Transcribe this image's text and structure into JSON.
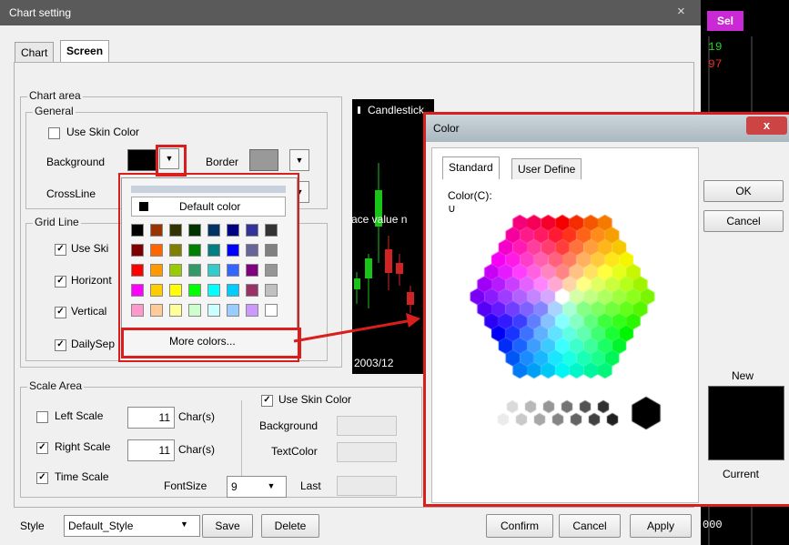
{
  "window": {
    "title": "Chart setting",
    "close_glyph": "×"
  },
  "tabs": [
    {
      "label": "Chart"
    },
    {
      "label": "Screen"
    }
  ],
  "chart_area": {
    "label": "Chart area",
    "general": {
      "label": "General",
      "use_skin_color": "Use Skin Color",
      "background_label": "Background",
      "border_label": "Border",
      "crossline_label": "CrossLine"
    },
    "grid_line": {
      "label": "Grid Line",
      "items": [
        "Use Ski",
        "Horizont",
        "Vertical",
        "DailySep"
      ]
    }
  },
  "popup": {
    "default_color": "Default color",
    "more_colors": "More colors...",
    "palette": [
      [
        "#000000",
        "#993300",
        "#333300",
        "#003300",
        "#003366",
        "#000080",
        "#333399",
        "#333333"
      ],
      [
        "#800000",
        "#FF6600",
        "#808000",
        "#008000",
        "#008080",
        "#0000FF",
        "#666699",
        "#808080"
      ],
      [
        "#FF0000",
        "#FF9900",
        "#99CC00",
        "#339966",
        "#33CCCC",
        "#3366FF",
        "#800080",
        "#969696"
      ],
      [
        "#FF00FF",
        "#FFCC00",
        "#FFFF00",
        "#00FF00",
        "#00FFFF",
        "#00CCFF",
        "#993366",
        "#C0C0C0"
      ],
      [
        "#FF99CC",
        "#FFCC99",
        "#FFFF99",
        "#CCFFCC",
        "#CCFFFF",
        "#99CCFF",
        "#CC99FF",
        "#FFFFFF"
      ]
    ]
  },
  "preview": {
    "title": "Candlestick",
    "text_mid": "ace value n",
    "date": "2003/12"
  },
  "scale_area": {
    "label": "Scale Area",
    "left_scale": "Left Scale",
    "right_scale": "Right Scale",
    "time_scale": "Time Scale",
    "left_value": "11",
    "right_value": "11",
    "chars_label": "Char(s)",
    "use_skin_color": "Use Skin Color",
    "background_label": "Background",
    "textcolor_label": "TextColor",
    "fontsize_label": "FontSize",
    "fontsize_value": "9",
    "last_label": "Last"
  },
  "footer": {
    "style_label": "Style",
    "style_value": "Default_Style",
    "save": "Save",
    "delete": "Delete",
    "confirm": "Confirm",
    "cancel": "Cancel",
    "apply": "Apply"
  },
  "color_dialog": {
    "title": "Color",
    "close": "x",
    "tabs": [
      "Standard",
      "User Define"
    ],
    "color_label": "Color(C):",
    "ok": "OK",
    "cancel": "Cancel",
    "new_label": "New",
    "current_label": "Current"
  },
  "side": {
    "sel": "Sel",
    "value1": "19",
    "value2": "97",
    "value3": "000"
  },
  "colors": {
    "highlight": "#d91e1e",
    "background_swatch": "#000000",
    "border_swatch": "#999999"
  }
}
